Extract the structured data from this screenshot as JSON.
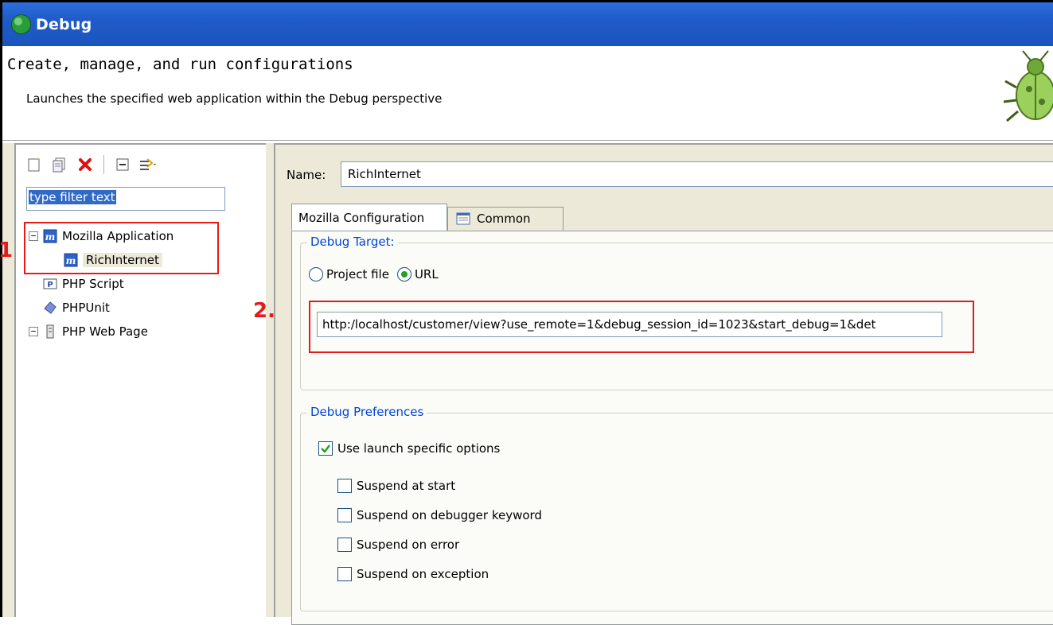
{
  "window": {
    "title": "Debug"
  },
  "header": {
    "title": "Create, manage, and run configurations",
    "description": "Launches the specified web application within the Debug perspective"
  },
  "toolbar": {
    "buttons": [
      "new-launch-config-icon",
      "duplicate-icon",
      "delete-icon",
      "collapse-all-icon",
      "filter-icon"
    ]
  },
  "filter": {
    "text": "type filter text"
  },
  "tree": {
    "items": [
      {
        "label": "Mozilla Application",
        "expanded": true,
        "icon": "mozilla-app-icon"
      },
      {
        "label": "RichInternet",
        "child": true,
        "selected": true,
        "icon": "mozilla-app-icon"
      },
      {
        "label": "PHP Script",
        "icon": "php-script-icon"
      },
      {
        "label": "PHPUnit",
        "icon": "phpunit-icon"
      },
      {
        "label": "PHP Web Page",
        "expanded": false,
        "icon": "php-web-page-icon"
      }
    ]
  },
  "config": {
    "name_label": "Name:",
    "name_value": "RichInternet",
    "tabs": [
      {
        "label": "Mozilla Configuration",
        "active": true
      },
      {
        "label": "Common",
        "active": false
      }
    ],
    "debug_target": {
      "legend": "Debug Target:",
      "options": [
        "Project file",
        "URL"
      ],
      "selected": "URL",
      "url": "http:/localhost/customer/view?use_remote=1&debug_session_id=1023&start_debug=1&det"
    },
    "debug_preferences": {
      "legend": "Debug Preferences",
      "use_launch_specific": {
        "label": "Use launch specific options",
        "checked": true
      },
      "options": [
        {
          "label": "Suspend at start",
          "checked": false
        },
        {
          "label": "Suspend on debugger keyword",
          "checked": false
        },
        {
          "label": "Suspend on error",
          "checked": false
        },
        {
          "label": "Suspend on exception",
          "checked": false
        }
      ]
    }
  },
  "annotations": {
    "marker1": "1.",
    "marker2": "2."
  },
  "colors": {
    "title_bar": "#1f5bc9",
    "highlight_box": "#e41b1b",
    "legend_text": "#0046d5"
  }
}
